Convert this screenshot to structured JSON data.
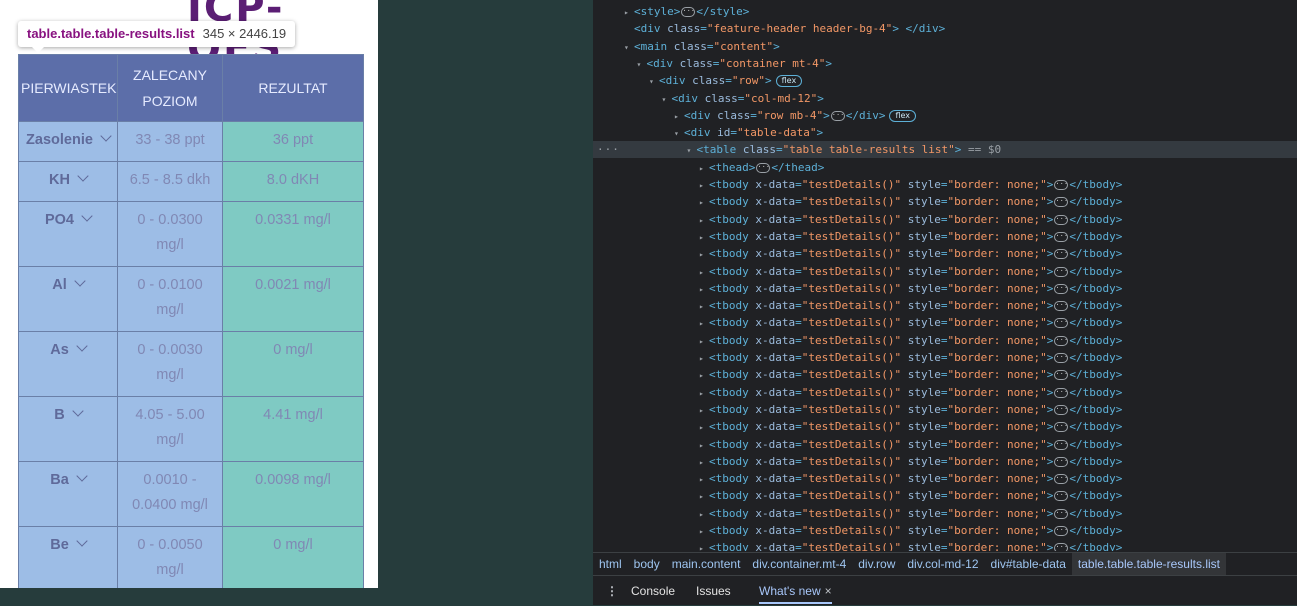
{
  "page": {
    "logo": "ICP-OES",
    "tooltip": {
      "selector": "table.table.table-results.list",
      "size": "345 × 2446.19"
    },
    "table": {
      "headers": [
        "PIERWIASTEK",
        "ZALECANY POZIOM",
        "REZULTAT"
      ],
      "rows": [
        {
          "element": "Zasolenie",
          "range": "33 - 38 ppt",
          "result": "36 ppt"
        },
        {
          "element": "KH",
          "range": "6.5 - 8.5 dkh",
          "result": "8.0 dKH"
        },
        {
          "element": "PO4",
          "range": "0 - 0.0300 mg/l",
          "result": "0.0331 mg/l"
        },
        {
          "element": "Al",
          "range": "0 - 0.0100 mg/l",
          "result": "0.0021 mg/l"
        },
        {
          "element": "As",
          "range": "0 - 0.0030 mg/l",
          "result": "0 mg/l"
        },
        {
          "element": "B",
          "range": "4.05 - 5.00 mg/l",
          "result": "4.41 mg/l"
        },
        {
          "element": "Ba",
          "range": "0.0010 - 0.0400 mg/l",
          "result": "0.0098 mg/l"
        },
        {
          "element": "Be",
          "range": "0 - 0.0050 mg/l",
          "result": "0 mg/l"
        }
      ]
    },
    "colors": {
      "header_bg": "#5c6ea9",
      "cell_blue": "#9dbde6",
      "cell_teal": "#7fcac3"
    }
  },
  "devtools": {
    "lines": [
      {
        "indent": 0,
        "arrow": "▸",
        "parts": [
          [
            "tag",
            "<style>"
          ],
          [
            "ell",
            ""
          ],
          [
            "tag",
            "</style>"
          ]
        ]
      },
      {
        "indent": 0,
        "arrow": "",
        "parts": [
          [
            "tag",
            "<div "
          ],
          [
            "an",
            "class"
          ],
          [
            "tag",
            "="
          ],
          [
            "av",
            "\"feature-header header-bg-4\""
          ],
          [
            "tag",
            "> </div>"
          ]
        ]
      },
      {
        "indent": 0,
        "arrow": "▾",
        "parts": [
          [
            "tag",
            "<main "
          ],
          [
            "an",
            "class"
          ],
          [
            "tag",
            "="
          ],
          [
            "av",
            "\"content\""
          ],
          [
            "tag",
            ">"
          ]
        ]
      },
      {
        "indent": 1,
        "arrow": "▾",
        "parts": [
          [
            "tag",
            "<div "
          ],
          [
            "an",
            "class"
          ],
          [
            "tag",
            "="
          ],
          [
            "av",
            "\"container mt-4\""
          ],
          [
            "tag",
            ">"
          ]
        ]
      },
      {
        "indent": 2,
        "arrow": "▾",
        "parts": [
          [
            "tag",
            "<div "
          ],
          [
            "an",
            "class"
          ],
          [
            "tag",
            "="
          ],
          [
            "av",
            "\"row\""
          ],
          [
            "tag",
            ">"
          ],
          [
            "badge",
            "flex"
          ]
        ]
      },
      {
        "indent": 3,
        "arrow": "▾",
        "parts": [
          [
            "tag",
            "<div "
          ],
          [
            "an",
            "class"
          ],
          [
            "tag",
            "="
          ],
          [
            "av",
            "\"col-md-12\""
          ],
          [
            "tag",
            ">"
          ]
        ]
      },
      {
        "indent": 4,
        "arrow": "▸",
        "parts": [
          [
            "tag",
            "<div "
          ],
          [
            "an",
            "class"
          ],
          [
            "tag",
            "="
          ],
          [
            "av",
            "\"row mb-4\""
          ],
          [
            "tag",
            ">"
          ],
          [
            "ell",
            ""
          ],
          [
            "tag",
            "</div>"
          ],
          [
            "badge",
            "flex"
          ]
        ]
      },
      {
        "indent": 4,
        "arrow": "▾",
        "parts": [
          [
            "tag",
            "<div "
          ],
          [
            "an",
            "id"
          ],
          [
            "tag",
            "="
          ],
          [
            "av",
            "\"table-data\""
          ],
          [
            "tag",
            ">"
          ]
        ]
      },
      {
        "indent": 5,
        "arrow": "▾",
        "sel": true,
        "parts": [
          [
            "tag",
            "<table "
          ],
          [
            "an",
            "class"
          ],
          [
            "tag",
            "="
          ],
          [
            "av",
            "\"table table-results  list\""
          ],
          [
            "tag",
            ">"
          ],
          [
            "eq0",
            " == $0"
          ]
        ]
      },
      {
        "indent": 6,
        "arrow": "▸",
        "parts": [
          [
            "tag",
            "<thead>"
          ],
          [
            "ell",
            ""
          ],
          [
            "tag",
            "</thead>"
          ]
        ]
      },
      {
        "indent": 6,
        "arrow": "▸",
        "tbody": true
      },
      {
        "indent": 6,
        "arrow": "▸",
        "tbody": true
      },
      {
        "indent": 6,
        "arrow": "▸",
        "tbody": true
      },
      {
        "indent": 6,
        "arrow": "▸",
        "tbody": true
      },
      {
        "indent": 6,
        "arrow": "▸",
        "tbody": true
      },
      {
        "indent": 6,
        "arrow": "▸",
        "tbody": true
      },
      {
        "indent": 6,
        "arrow": "▸",
        "tbody": true
      },
      {
        "indent": 6,
        "arrow": "▸",
        "tbody": true
      },
      {
        "indent": 6,
        "arrow": "▸",
        "tbody": true
      },
      {
        "indent": 6,
        "arrow": "▸",
        "tbody": true
      },
      {
        "indent": 6,
        "arrow": "▸",
        "tbody": true
      },
      {
        "indent": 6,
        "arrow": "▸",
        "tbody": true
      },
      {
        "indent": 6,
        "arrow": "▸",
        "tbody": true
      },
      {
        "indent": 6,
        "arrow": "▸",
        "tbody": true
      },
      {
        "indent": 6,
        "arrow": "▸",
        "tbody": true
      },
      {
        "indent": 6,
        "arrow": "▸",
        "tbody": true
      },
      {
        "indent": 6,
        "arrow": "▸",
        "tbody": true
      },
      {
        "indent": 6,
        "arrow": "▸",
        "tbody": true
      },
      {
        "indent": 6,
        "arrow": "▸",
        "tbody": true
      },
      {
        "indent": 6,
        "arrow": "▸",
        "tbody": true
      },
      {
        "indent": 6,
        "arrow": "▸",
        "tbody": true
      },
      {
        "indent": 6,
        "arrow": "▸",
        "tbody": true
      }
    ],
    "tbody_parts": [
      [
        "tag",
        "<tbody "
      ],
      [
        "an",
        "x-data"
      ],
      [
        "tag",
        "="
      ],
      [
        "av",
        "\"testDetails()\""
      ],
      [
        "tag",
        " "
      ],
      [
        "an",
        "style"
      ],
      [
        "tag",
        "="
      ],
      [
        "av",
        "\"border: none;\""
      ],
      [
        "tag",
        ">"
      ],
      [
        "ell",
        ""
      ],
      [
        "tag",
        "</tbody>"
      ]
    ],
    "gutter_marker": "···",
    "breadcrumbs": [
      "html",
      "body",
      "main.content",
      "div.container.mt-4",
      "div.row",
      "div.col-md-12",
      "div#table-data",
      "table.table.table-results.list"
    ],
    "drawer": {
      "menu_icon": "⋮",
      "tabs": [
        "Console",
        "Issues",
        "What's new"
      ],
      "close": "×"
    }
  }
}
